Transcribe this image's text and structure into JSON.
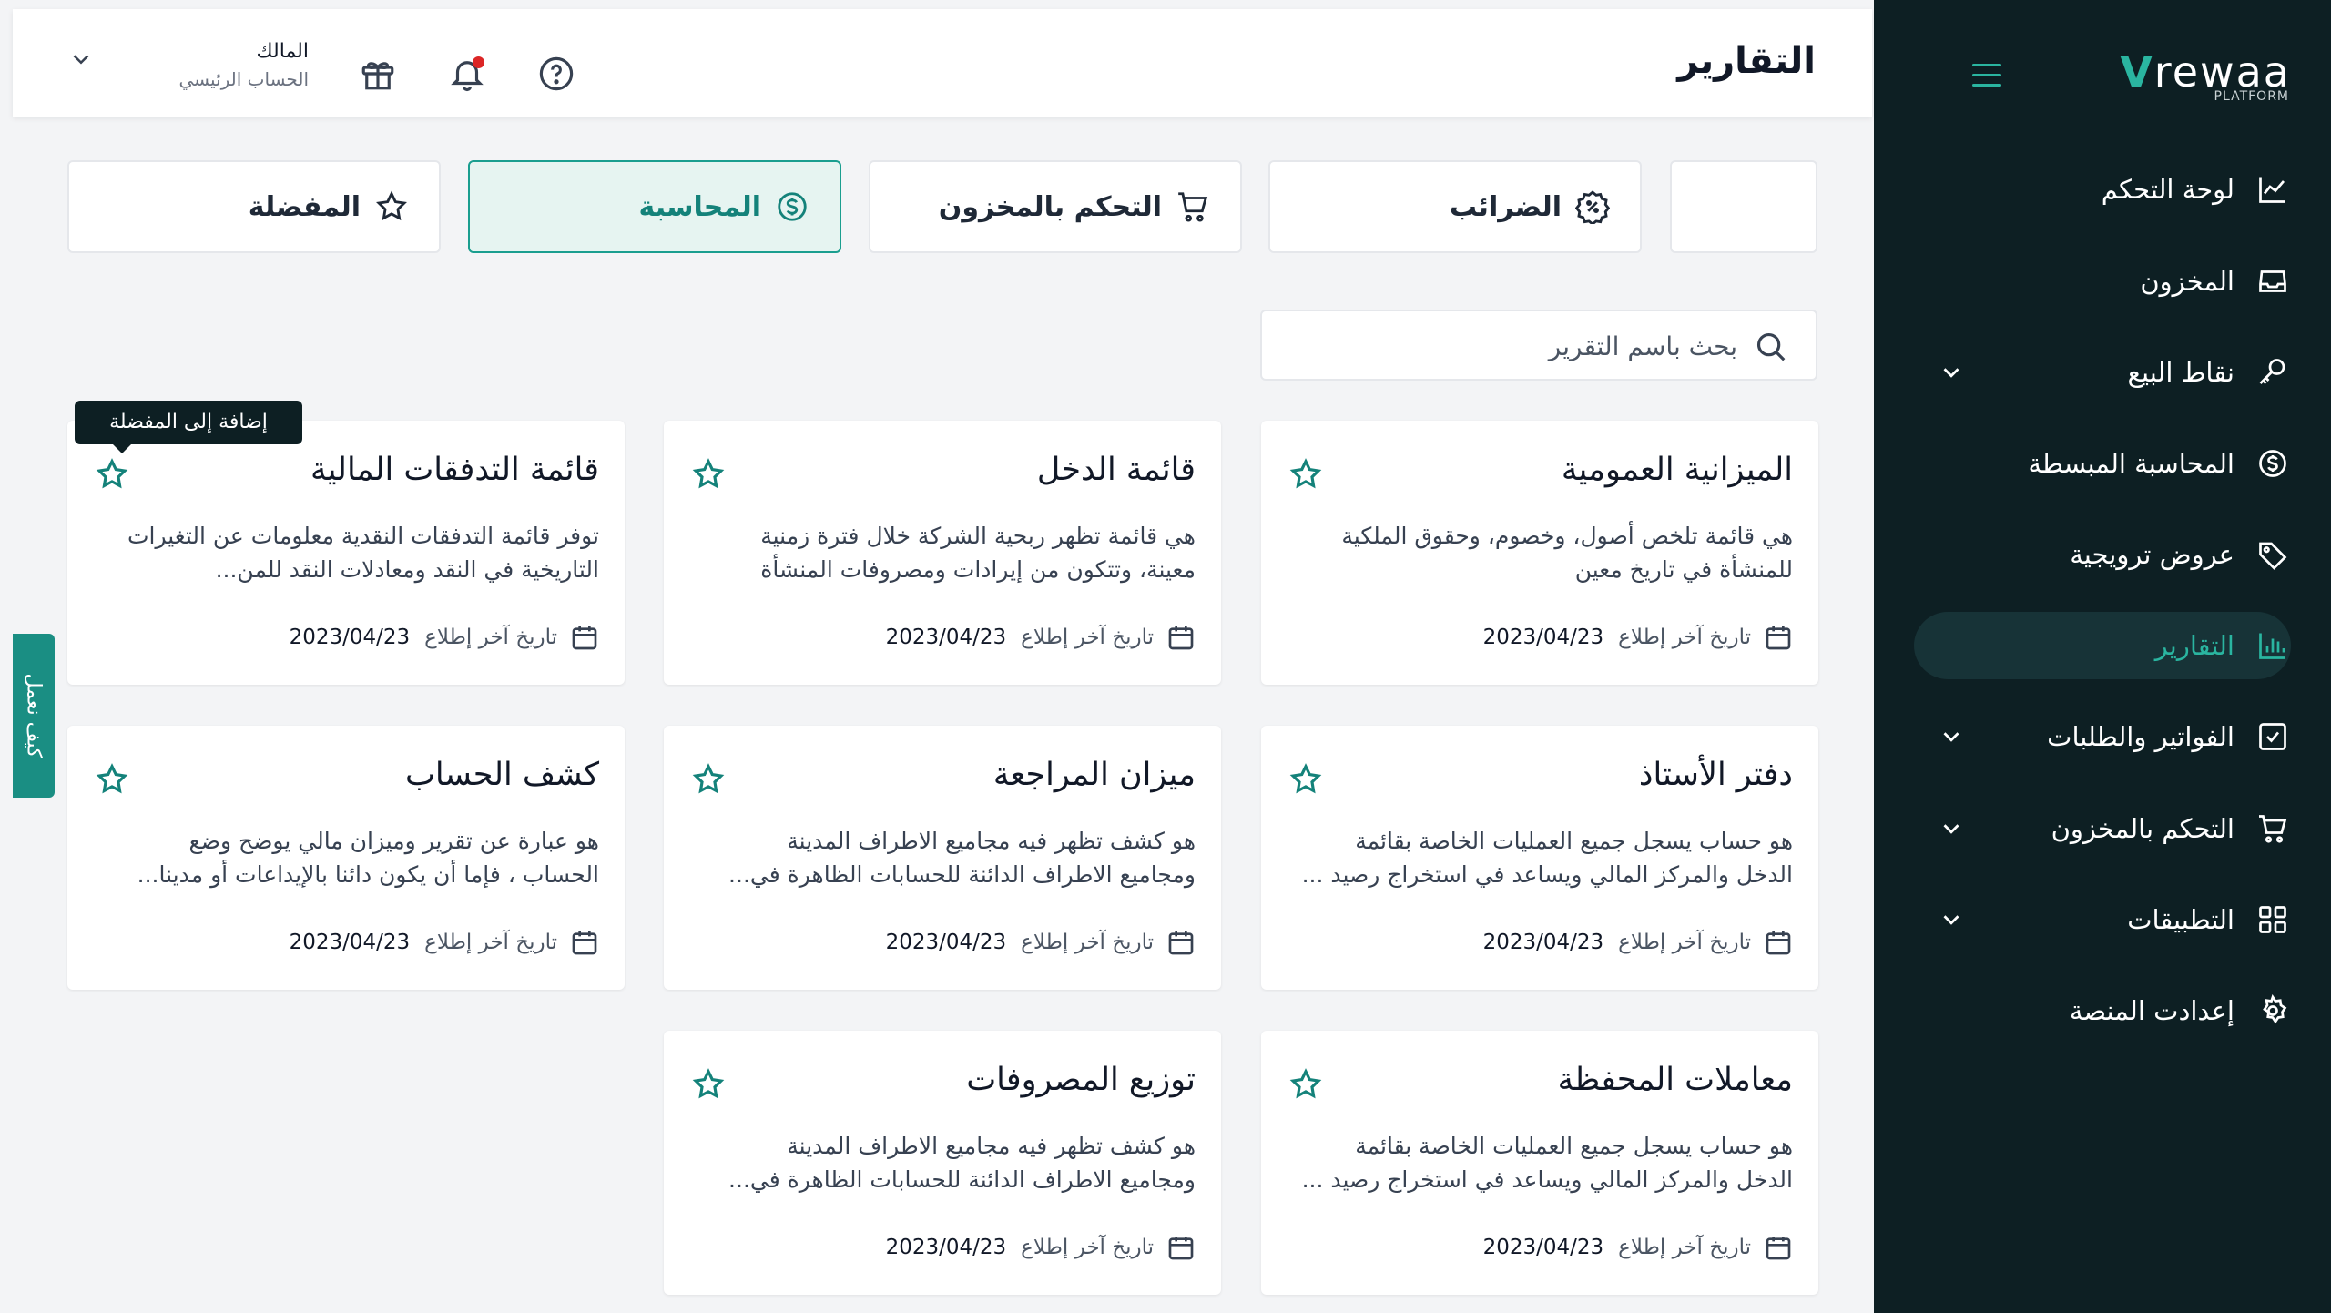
{
  "sidebar": {
    "brand": {
      "name": "rewaa",
      "sub": "PLATFORM"
    },
    "items": [
      {
        "label": "لوحة التحكم",
        "icon": "chart-line-icon",
        "chevron": false,
        "active": false
      },
      {
        "label": "المخزون",
        "icon": "inbox-icon",
        "chevron": false,
        "active": false
      },
      {
        "label": "نقاط البيع",
        "icon": "key-icon",
        "chevron": true,
        "active": false
      },
      {
        "label": "المحاسبة المبسطة",
        "icon": "dollar-circle-icon",
        "chevron": false,
        "active": false
      },
      {
        "label": "عروض ترويجية",
        "icon": "tag-icon",
        "chevron": false,
        "active": false
      },
      {
        "label": "التقارير",
        "icon": "bar-chart-icon",
        "chevron": false,
        "active": true
      },
      {
        "label": "الفواتير والطلبات",
        "icon": "check-square-icon",
        "chevron": true,
        "active": false
      },
      {
        "label": "التحكم بالمخزون",
        "icon": "cart-icon",
        "chevron": true,
        "active": false
      },
      {
        "label": "التطبيقات",
        "icon": "grid-icon",
        "chevron": true,
        "active": false
      },
      {
        "label": "إعدادت المنصة",
        "icon": "gear-icon",
        "chevron": false,
        "active": false
      }
    ]
  },
  "header": {
    "title": "التقارير",
    "user_name": "المالك",
    "user_role": "الحساب الرئيسي"
  },
  "tabs": [
    {
      "label": "المفضلة",
      "icon": "star-icon",
      "active": false
    },
    {
      "label": "المحاسبة",
      "icon": "dollar-circle-icon",
      "active": true
    },
    {
      "label": "التحكم بالمخزون",
      "icon": "cart-icon",
      "active": false
    },
    {
      "label": "الضرائب",
      "icon": "percent-badge-icon",
      "active": false
    },
    {
      "label": "",
      "icon": "",
      "active": false
    }
  ],
  "search": {
    "placeholder": "بحث باسم التقرير"
  },
  "cards": [
    {
      "title": "الميزانية العمومية",
      "desc": "هي قائمة تلخص أصول، وخصوم، وحقوق الملكية للمنشأة في تاريخ معين",
      "meta_label": "تاريخ آخر إطلاع",
      "date": "2023/04/23"
    },
    {
      "title": "قائمة الدخل",
      "desc": "هي قائمة تظهر ربحية الشركة خلال فترة زمنية معينة، وتتكون من إيرادات ومصروفات المنشأة",
      "meta_label": "تاريخ آخر إطلاع",
      "date": "2023/04/23"
    },
    {
      "title": "قائمة التدفقات المالية",
      "desc": "توفر قائمة التدفقات النقدية معلومات عن التغيرات التاريخية في النقد ومعادلات النقد للمن...",
      "meta_label": "تاريخ آخر إطلاع",
      "date": "2023/04/23"
    },
    {
      "title": "دفتر الأستاذ",
      "desc": "هو حساب يسجل جميع العمليات الخاصة بقائمة الدخل والمركز المالي ويساعد في استخراج رصيد ...",
      "meta_label": "تاريخ آخر إطلاع",
      "date": "2023/04/23"
    },
    {
      "title": "ميزان المراجعة",
      "desc": "هو كشف تظهر فيه مجاميع الاطراف المدينة ومجاميع الاطراف الدائنة للحسابات الظاهرة في...",
      "meta_label": "تاريخ آخر إطلاع",
      "date": "2023/04/23"
    },
    {
      "title": "كشف الحساب",
      "desc": "هو عبارة عن تقرير وميزان مالي يوضح وضع الحساب ، فإما أن يكون دائنا بالإيداعات أو مدينا...",
      "meta_label": "تاريخ آخر إطلاع",
      "date": "2023/04/23"
    },
    {
      "title": "معاملات المحفظة",
      "desc": "هو حساب يسجل جميع العمليات الخاصة بقائمة الدخل والمركز المالي ويساعد في استخراج رصيد ...",
      "meta_label": "تاريخ آخر إطلاع",
      "date": "2023/04/23"
    },
    {
      "title": "توزيع المصروفات",
      "desc": "هو كشف تظهر فيه مجاميع الاطراف المدينة ومجاميع الاطراف الدائنة للحسابات الظاهرة في...",
      "meta_label": "تاريخ آخر إطلاع",
      "date": "2023/04/23"
    }
  ],
  "tooltip": "إضافة إلى المفضلة",
  "side_tab": "كيف نعمل",
  "colors": {
    "accent": "#2ab5a0",
    "sidebar": "#0d1f23",
    "notification": "#dc2626"
  }
}
